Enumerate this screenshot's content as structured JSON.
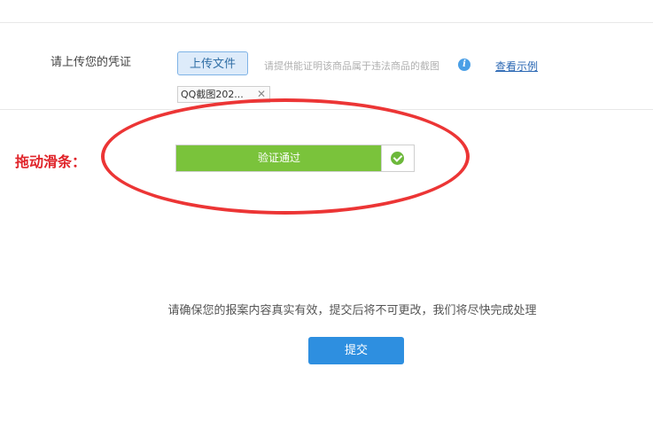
{
  "evidence": {
    "label": "请上传您的凭证",
    "upload_button": "上传文件",
    "hint": "请提供能证明该商品属于违法商品的截图",
    "info_icon": "i",
    "example_link": "查看示例",
    "file_name": "QQ截图202...",
    "remove_glyph": "✕"
  },
  "annotation": {
    "drag_label": "拖动滑条："
  },
  "slider": {
    "text": "验证通过",
    "progress": 1.0,
    "check_icon": "check-circle-icon"
  },
  "footer": {
    "notice": "请确保您的报案内容真实有效，提交后将不可更改，我们将尽快完成处理",
    "submit": "提交"
  },
  "colors": {
    "accent": "#2e8fe0",
    "success": "#7ac33b",
    "annotation": "#e0242a"
  }
}
